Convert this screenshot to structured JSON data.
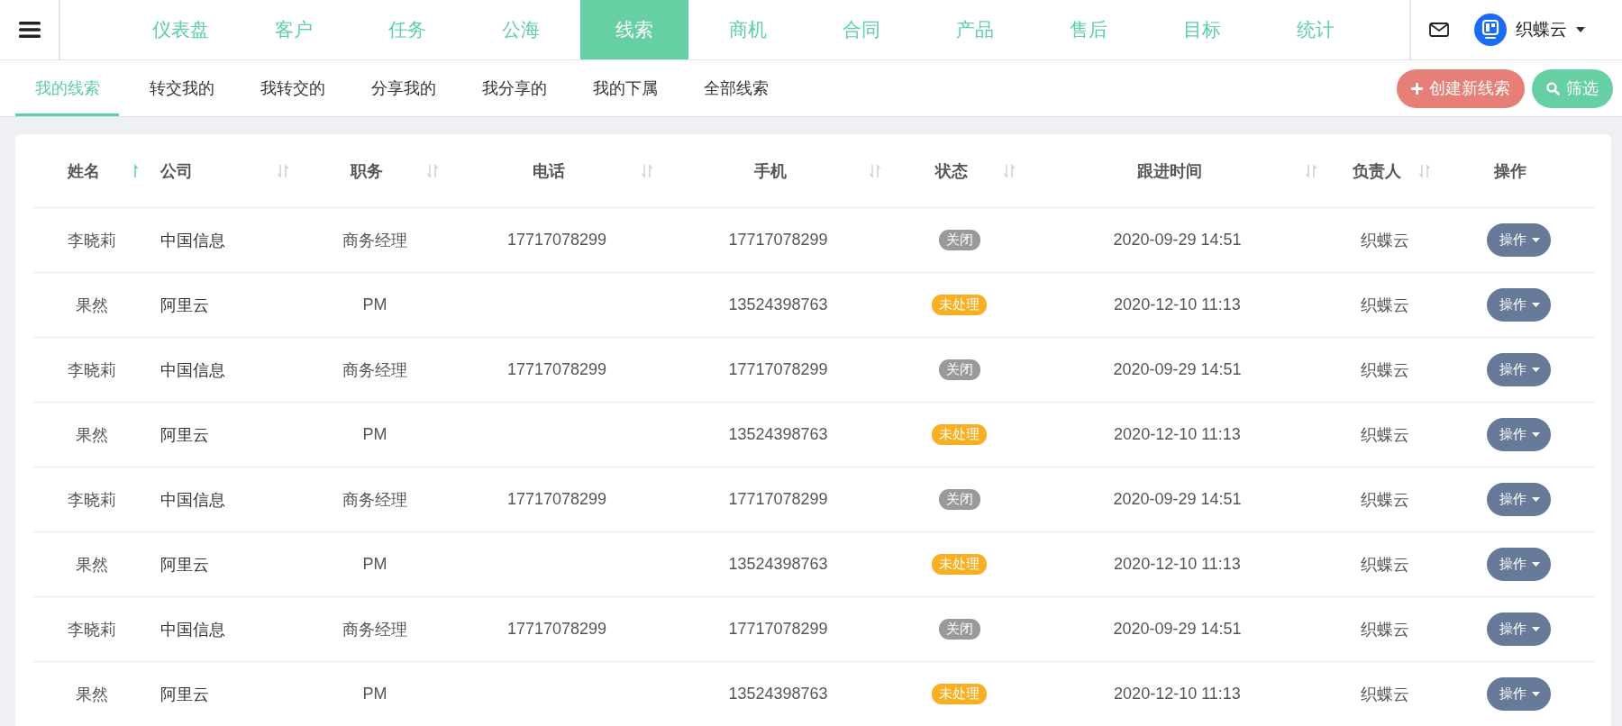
{
  "nav": {
    "items": [
      {
        "label": "仪表盘",
        "selected": false
      },
      {
        "label": "客户",
        "selected": false
      },
      {
        "label": "任务",
        "selected": false
      },
      {
        "label": "公海",
        "selected": false
      },
      {
        "label": "线索",
        "selected": true
      },
      {
        "label": "商机",
        "selected": false
      },
      {
        "label": "合同",
        "selected": false
      },
      {
        "label": "产品",
        "selected": false
      },
      {
        "label": "售后",
        "selected": false
      },
      {
        "label": "目标",
        "selected": false
      },
      {
        "label": "统计",
        "selected": false
      }
    ],
    "user": "织蝶云"
  },
  "subtabs": [
    {
      "label": "我的线索",
      "selected": true
    },
    {
      "label": "转交我的",
      "selected": false
    },
    {
      "label": "我转交的",
      "selected": false
    },
    {
      "label": "分享我的",
      "selected": false
    },
    {
      "label": "我分享的",
      "selected": false
    },
    {
      "label": "我的下属",
      "selected": false
    },
    {
      "label": "全部线索",
      "selected": false
    }
  ],
  "actions": {
    "create": "创建新线索",
    "filter": "筛选"
  },
  "table": {
    "columns": [
      {
        "label": "姓名",
        "sorted": true
      },
      {
        "label": "公司",
        "sorted": false
      },
      {
        "label": "职务",
        "sorted": false
      },
      {
        "label": "电话",
        "sorted": false
      },
      {
        "label": "手机",
        "sorted": false
      },
      {
        "label": "状态",
        "sorted": false
      },
      {
        "label": "跟进时间",
        "sorted": false
      },
      {
        "label": "负责人",
        "sorted": false
      },
      {
        "label": "操作"
      }
    ],
    "rows": [
      {
        "name": "李晓莉",
        "company": "中国信息",
        "title": "商务经理",
        "phone": "17717078299",
        "mobile": "17717078299",
        "status": {
          "text": "关闭",
          "color": "#9a9a9a"
        },
        "follow_up": "2020-09-29 14:51",
        "owner": "织蝶云",
        "action": "操作"
      },
      {
        "name": "果然",
        "company": "阿里云",
        "title": "PM",
        "mobile": "13524398763",
        "status": {
          "text": "未处理",
          "color": "#f7b022"
        },
        "follow_up": "2020-12-10 11:13",
        "owner": "织蝶云",
        "action": "操作"
      },
      {
        "name": "李晓莉",
        "company": "中国信息",
        "title": "商务经理",
        "phone": "17717078299",
        "mobile": "17717078299",
        "status": {
          "text": "关闭",
          "color": "#9a9a9a"
        },
        "follow_up": "2020-09-29 14:51",
        "owner": "织蝶云",
        "action": "操作"
      },
      {
        "name": "果然",
        "company": "阿里云",
        "title": "PM",
        "mobile": "13524398763",
        "status": {
          "text": "未处理",
          "color": "#f7b022"
        },
        "follow_up": "2020-12-10 11:13",
        "owner": "织蝶云",
        "action": "操作"
      },
      {
        "name": "李晓莉",
        "company": "中国信息",
        "title": "商务经理",
        "phone": "17717078299",
        "mobile": "17717078299",
        "status": {
          "text": "关闭",
          "color": "#9a9a9a"
        },
        "follow_up": "2020-09-29 14:51",
        "owner": "织蝶云",
        "action": "操作"
      },
      {
        "name": "果然",
        "company": "阿里云",
        "title": "PM",
        "mobile": "13524398763",
        "status": {
          "text": "未处理",
          "color": "#f7b022"
        },
        "follow_up": "2020-12-10 11:13",
        "owner": "织蝶云",
        "action": "操作"
      },
      {
        "name": "李晓莉",
        "company": "中国信息",
        "title": "商务经理",
        "phone": "17717078299",
        "mobile": "17717078299",
        "status": {
          "text": "关闭",
          "color": "#9a9a9a"
        },
        "follow_up": "2020-09-29 14:51",
        "owner": "织蝶云",
        "action": "操作"
      },
      {
        "name": "果然",
        "company": "阿里云",
        "title": "PM",
        "mobile": "13524398763",
        "status": {
          "text": "未处理",
          "color": "#f7b022"
        },
        "follow_up": "2020-12-10 11:13",
        "owner": "织蝶云",
        "action": "操作"
      }
    ]
  }
}
